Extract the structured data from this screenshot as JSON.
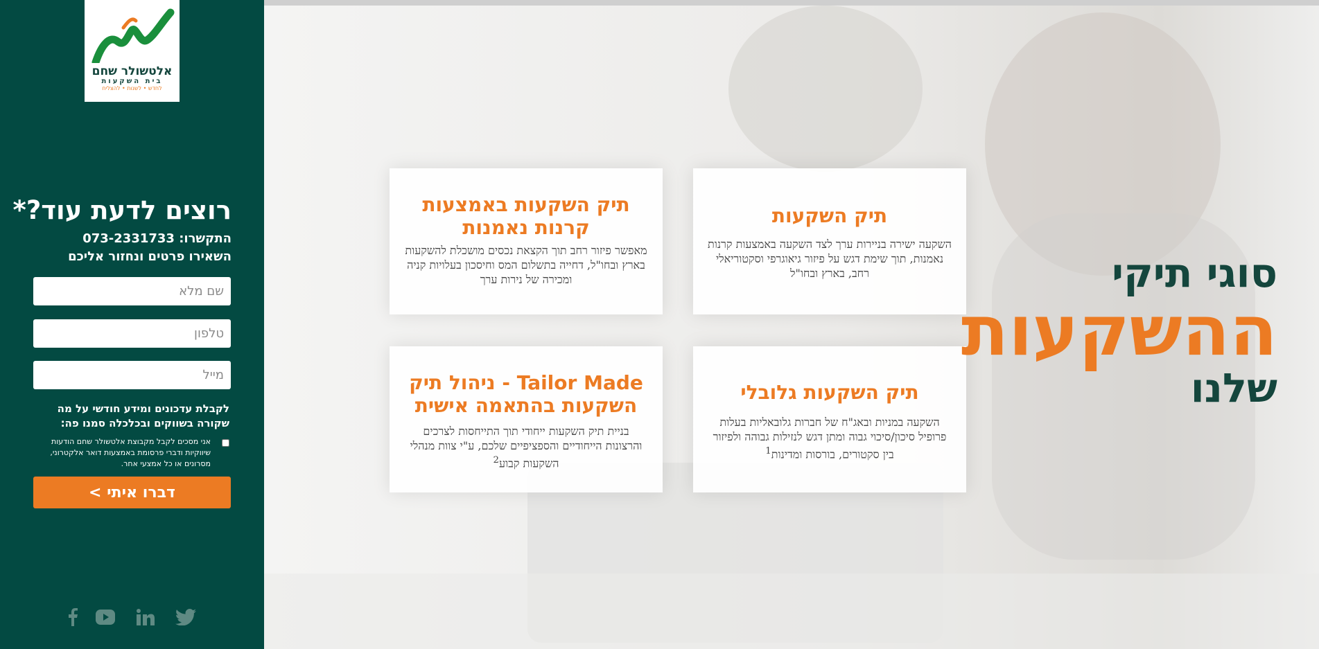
{
  "logo": {
    "name": "אלטשולר שחם",
    "sub": "בית השקעות",
    "tagline": "לחדש • לשנות • להצליח"
  },
  "contact": {
    "title": "רוצים לדעת עוד?*",
    "phone_line": "התקשרו: 073-2331733",
    "leave_details": "השאירו פרטים ונחזור אליכם",
    "name_placeholder": "שם מלא",
    "phone_placeholder": "טלפון",
    "email_placeholder": "מייל",
    "updates_text": "לקבלת עדכונים ומידע חודשי על מה שקורה בשווקים ובכלכלה סמנו פה:",
    "consent_text": "אני מסכים לקבל מקבוצת אלטשולר שחם הודעות שיווקיות ודברי פרסומת באמצעות דואר אלקטרוני, מסרונים או כל אמצעי אחר.",
    "submit_label": "דברו איתי >"
  },
  "social": {
    "icons": [
      "facebook-icon",
      "youtube-icon",
      "linkedin-icon",
      "twitter-icon"
    ]
  },
  "hero": {
    "line1": "סוגי תיקי",
    "line2": "ההשקעות",
    "line3": "שלנו"
  },
  "cards": [
    {
      "title": "תיק השקעות",
      "text": "השקעה ישירה בניירות ערך לצד השקעה באמצעות קרנות נאמנות, תוך שימת דגש על פיזור גיאוגרפי וסקטוריאלי רחב, בארץ ובחו\"ל"
    },
    {
      "title": "תיק השקעות באמצעות קרנות נאמנות",
      "text": "מאפשר פיזור רחב תוך הקצאת נכסים מושכלת להשקעות בארץ ובחו\"ל, דחייה בתשלום המס וחיסכון בעלויות קניה ומכירה של נירות ערך"
    },
    {
      "title": "תיק השקעות גלובלי",
      "text": "השקעה במניות ובאג\"ח של חברות גלובאליות בעלות פרופיל סיכון/סיכוי גבוה ומתן דגש לנזילות גבוהה ולפיזור בין סקטורים, בורסות ומדינות",
      "footnote": "1"
    },
    {
      "title": "Tailor Made - ניהול תיק השקעות בהתאמה אישית",
      "text": "בניית תיק השקעות ייחודי תוך התייחסות לצרכים והרצונות הייחודיים והספציפיים שלכם, ע\"י צוות מנהלי השקעות קבוע",
      "footnote": "2"
    }
  ],
  "colors": {
    "brand_green": "#034a42",
    "brand_orange": "#ec7b23"
  }
}
